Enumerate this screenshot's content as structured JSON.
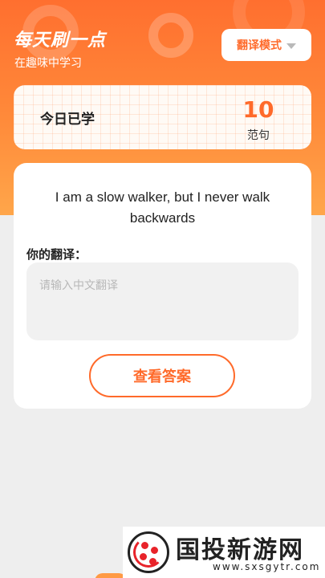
{
  "header": {
    "title": "每天刷一点",
    "subtitle": "在趣味中学习",
    "mode_button_label": "翻译模式"
  },
  "stats": {
    "label": "今日已学",
    "value": "10",
    "unit": "范句"
  },
  "exercise": {
    "sentence": "I am a slow walker, but I never walk backwards",
    "translation_label": "你的翻译：",
    "translation_value": "",
    "translation_placeholder": "请输入中文翻译",
    "check_answer_label": "查看答案"
  },
  "watermark": {
    "title": "国投新游网",
    "url": "www.sxsgytr.com"
  },
  "colors": {
    "accent": "#ff6a2a",
    "header_gradient_top": "#ff6f2f",
    "header_gradient_bottom": "#ffa64a",
    "background": "#eeeeee"
  },
  "icons": {
    "mode_dropdown": "chevron-down-icon"
  }
}
